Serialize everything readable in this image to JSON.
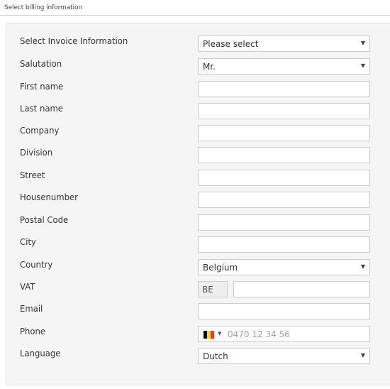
{
  "section": {
    "title": "Select billing information"
  },
  "form": {
    "labels": {
      "invoice": "Select Invoice Information",
      "salutation": "Salutation",
      "first_name": "First name",
      "last_name": "Last name",
      "company": "Company",
      "division": "Division",
      "street": "Street",
      "housenumber": "Housenumber",
      "postal_code": "Postal Code",
      "city": "City",
      "country": "Country",
      "vat": "VAT",
      "email": "Email",
      "phone": "Phone",
      "language": "Language"
    },
    "values": {
      "invoice": "Please select",
      "salutation": "Mr.",
      "first_name": "",
      "last_name": "",
      "company": "",
      "division": "",
      "street": "",
      "housenumber": "",
      "postal_code": "",
      "city": "",
      "country": "Belgium",
      "vat_prefix": "BE",
      "vat_number": "",
      "email": "",
      "language": "Dutch"
    },
    "phone": {
      "placeholder": "0470 12 34 56",
      "flag_icon": "belgium-flag-icon",
      "flag_colors": [
        "#000000",
        "#fdda24",
        "#ef3340"
      ]
    },
    "icons": {
      "caret": "caret-down-icon"
    }
  }
}
